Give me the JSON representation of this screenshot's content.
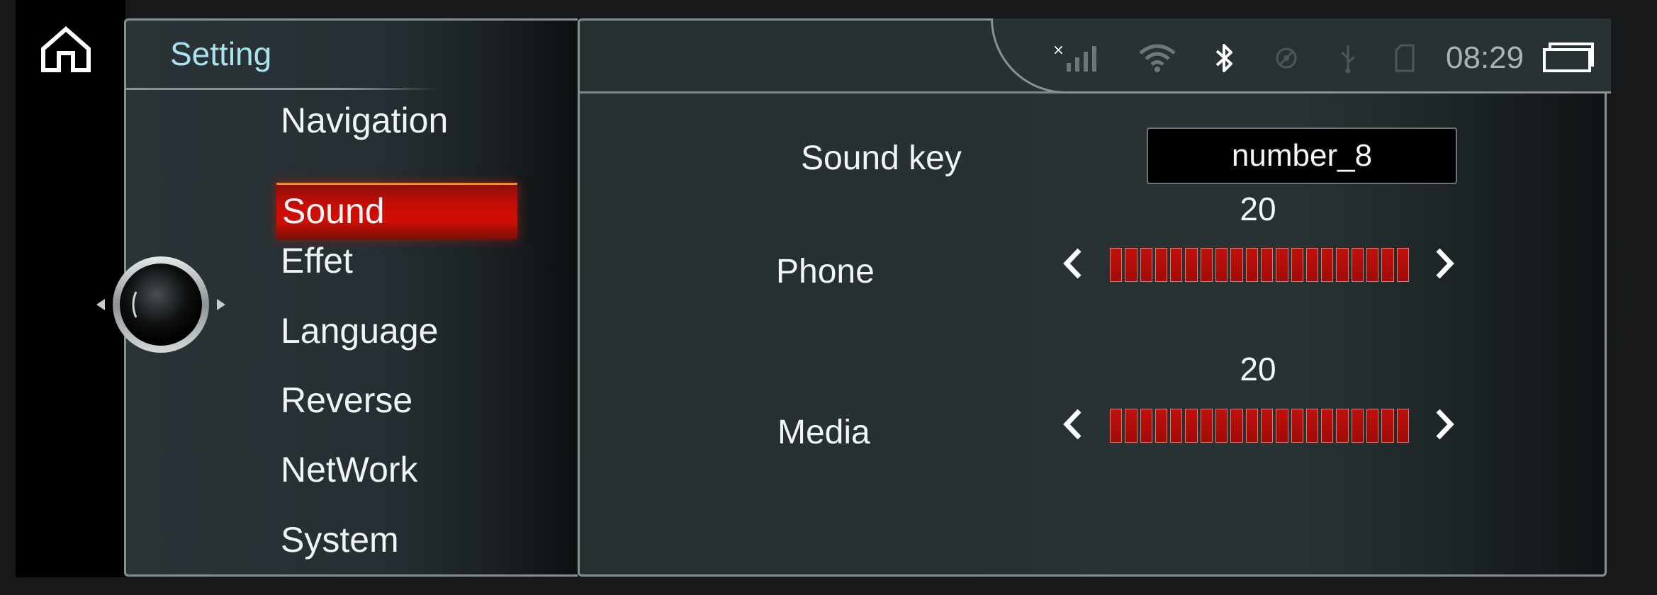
{
  "sidebar": {
    "title": "Setting",
    "items": [
      {
        "label": "Navigation",
        "active": false
      },
      {
        "label": "Sound",
        "active": true
      },
      {
        "label": "Effet",
        "active": false
      },
      {
        "label": "Language",
        "active": false
      },
      {
        "label": "Reverse",
        "active": false
      },
      {
        "label": "NetWork",
        "active": false
      },
      {
        "label": "System",
        "active": false
      }
    ]
  },
  "status_bar": {
    "time": "08:29",
    "icons": [
      "no-signal-icon",
      "wifi-icon",
      "bluetooth-icon",
      "gps-icon",
      "usb-icon",
      "sd-card-icon",
      "recent-apps-icon"
    ]
  },
  "sound": {
    "sound_key": {
      "label": "Sound key",
      "value": "number_8"
    },
    "phone": {
      "label": "Phone",
      "value": "20",
      "level": 20,
      "max": 20
    },
    "media": {
      "label": "Media",
      "value": "20",
      "level": 20,
      "max": 20
    }
  },
  "colors": {
    "accent_red": "#c20d05",
    "title_cyan": "#a9e3ef",
    "panel": "#283234"
  }
}
